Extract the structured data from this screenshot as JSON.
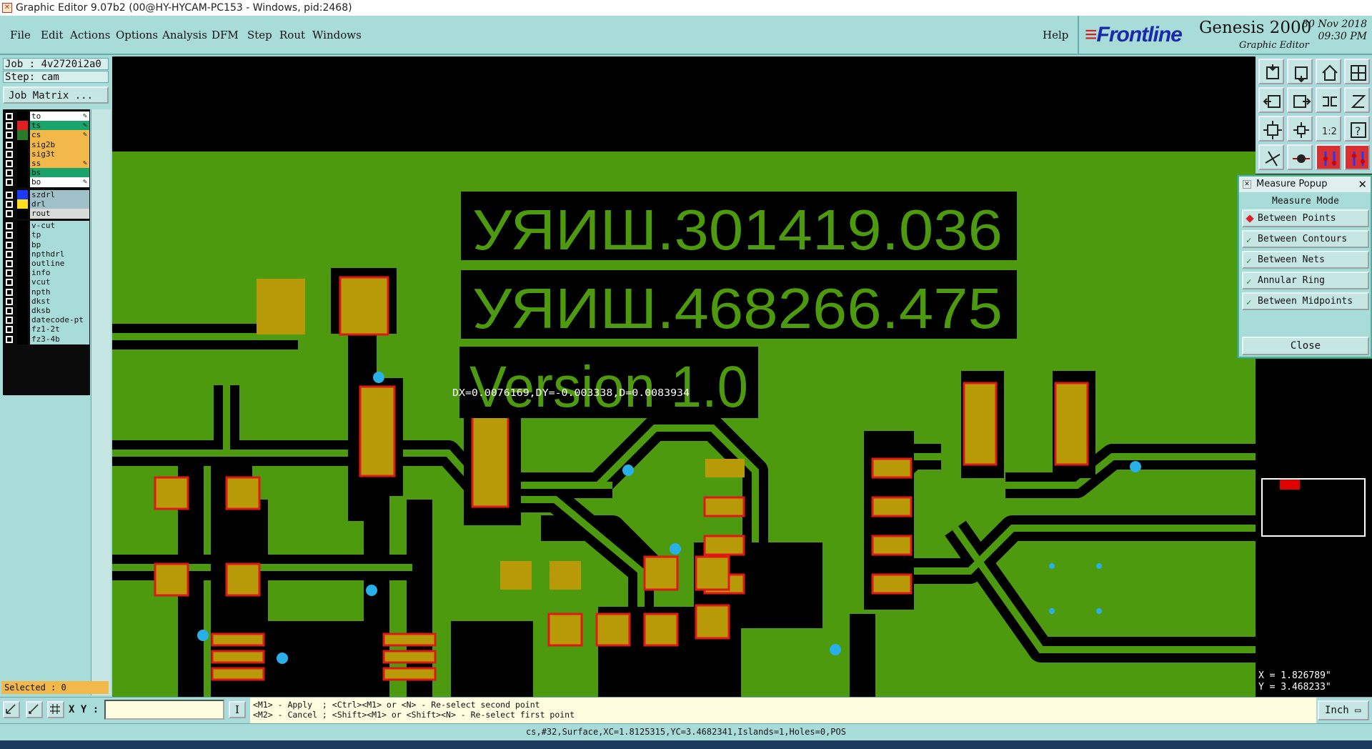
{
  "window": {
    "title": "Graphic Editor 9.07b2 (00@HY-HYCAM-PC153 - Windows, pid:2468)"
  },
  "menu": [
    "File",
    "Edit",
    "Actions",
    "Options",
    "Analysis",
    "DFM",
    "Step",
    "Rout",
    "Windows"
  ],
  "help_label": "Help",
  "logo": {
    "brand": "Frontline",
    "product": "Genesis 2000",
    "subtitle": "Graphic Editor",
    "date": "30 Nov 2018",
    "time": "09:30 PM"
  },
  "job": {
    "job_label": "Job : 4v2720i2a0",
    "step_label": "Step: cam",
    "matrix_button": "Job Matrix ..."
  },
  "layers": [
    {
      "name": "to",
      "color": "#ffffff",
      "swatch": "#000000",
      "flag": "✎"
    },
    {
      "name": "ts",
      "color": "#1aa36a",
      "swatch": "#e02020",
      "flag": "✎"
    },
    {
      "name": "cs",
      "color": "#f2b84a",
      "swatch": "#2a7a2a",
      "flag": "✎",
      "active": true
    },
    {
      "name": "sig2b",
      "color": "#f2b84a",
      "swatch": "#000000",
      "flag": ""
    },
    {
      "name": "sig3t",
      "color": "#f2b84a",
      "swatch": "#000000",
      "flag": ""
    },
    {
      "name": "ss",
      "color": "#f2b84a",
      "swatch": "#000000",
      "flag": "✎"
    },
    {
      "name": "bs",
      "color": "#1aa36a",
      "swatch": "#000000",
      "flag": ""
    },
    {
      "name": "bo",
      "color": "#ffffff",
      "swatch": "#000000",
      "flag": "✎"
    },
    {
      "name": "szdrl",
      "color": "#9fc0c8",
      "swatch": "#1a3aff",
      "flag": "",
      "gap": true
    },
    {
      "name": "drl",
      "color": "#9fc0c8",
      "swatch": "#ffe020",
      "flag": ""
    },
    {
      "name": "rout",
      "color": "#d8dcd8",
      "swatch": "#000000",
      "flag": ""
    },
    {
      "name": "v-cut",
      "color": "#a8dcd8",
      "swatch": "#000000",
      "flag": "",
      "gap": true
    },
    {
      "name": "tp",
      "color": "#a8dcd8",
      "swatch": "#000000",
      "flag": ""
    },
    {
      "name": "bp",
      "color": "#a8dcd8",
      "swatch": "#000000",
      "flag": ""
    },
    {
      "name": "npthdrl",
      "color": "#a8dcd8",
      "swatch": "#000000",
      "flag": ""
    },
    {
      "name": "outline",
      "color": "#a8dcd8",
      "swatch": "#000000",
      "flag": ""
    },
    {
      "name": "info",
      "color": "#a8dcd8",
      "swatch": "#000000",
      "flag": ""
    },
    {
      "name": "vcut",
      "color": "#a8dcd8",
      "swatch": "#000000",
      "flag": ""
    },
    {
      "name": "npth",
      "color": "#a8dcd8",
      "swatch": "#000000",
      "flag": ""
    },
    {
      "name": "dkst",
      "color": "#a8dcd8",
      "swatch": "#000000",
      "flag": ""
    },
    {
      "name": "dksb",
      "color": "#a8dcd8",
      "swatch": "#000000",
      "flag": ""
    },
    {
      "name": "datecode-pt",
      "color": "#a8dcd8",
      "swatch": "#000000",
      "flag": ""
    },
    {
      "name": "fz1-2t",
      "color": "#a8dcd8",
      "swatch": "#000000",
      "flag": ""
    },
    {
      "name": "fz3-4b",
      "color": "#a8dcd8",
      "swatch": "#000000",
      "flag": ""
    }
  ],
  "selected_label": "Selected : 0",
  "board": {
    "text1": "УЯИШ.301419.036",
    "text2": "УЯИШ.468266.475",
    "text3": "Version 1.0",
    "measure_readout": "DX=0.0076169,DY=-0.003338,D=0.0083934",
    "colors": {
      "board": "#4e9a0e",
      "copper": "#b89a08",
      "pad_outline": "#e01818",
      "void": "#000000",
      "via": "#2ab0e8"
    }
  },
  "measure_popup": {
    "title": "Measure Popup",
    "heading": "Measure Mode",
    "options": [
      "Between Points",
      "Between Contours",
      "Between Nets",
      "Annular Ring",
      "Between Midpoints"
    ],
    "selected_index": 0,
    "close_label": "Close"
  },
  "tools": [
    "zoom-home-icon",
    "zoom-in-icon",
    "home-icon",
    "split-view-icon",
    "pan-left-icon",
    "pan-right-icon",
    "flip-icon",
    "mirror-icon",
    "fit-all-icon",
    "fit-selection-icon",
    "ratio-icon",
    "help-icon",
    "measure-icon",
    "probe-icon",
    "net-a-icon",
    "net-b-icon"
  ],
  "cursor": {
    "x_label": "X = 1.826789\"",
    "y_label": "Y = 3.468233\""
  },
  "xy_label": "X Y :",
  "xy_value": "",
  "hints": [
    "<M1> - Apply  ; <Ctrl><M1> or <N> - Re-select second point",
    "<M2> - Cancel ; <Shift><M1> or <Shift><N> - Re-select first point"
  ],
  "units": "Inch",
  "info_bar": "cs,#32,Surface,XC=1.8125315,YC=3.4682341,Islands=1,Holes=0,POS"
}
